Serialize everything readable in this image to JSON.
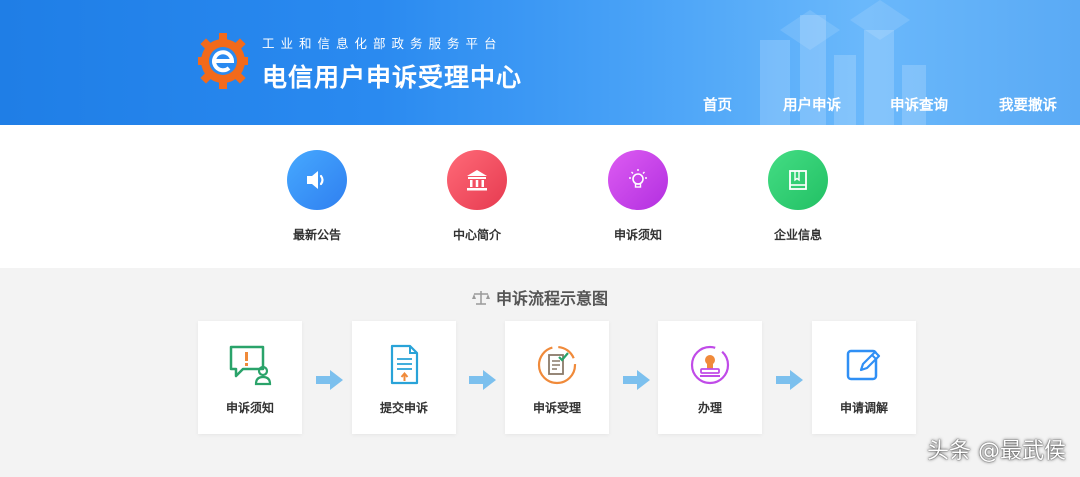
{
  "header": {
    "subtitle": "工业和信息化部政务服务平台",
    "title": "电信用户申诉受理中心",
    "logo_icon": "e-gear-logo-icon",
    "nav": [
      {
        "label": "首页"
      },
      {
        "label": "用户申诉"
      },
      {
        "label": "申诉查询"
      },
      {
        "label": "我要撤诉"
      }
    ]
  },
  "quick_links": [
    {
      "label": "最新公告",
      "icon": "speaker-icon",
      "color": "#2f8ff5"
    },
    {
      "label": "中心简介",
      "icon": "building-icon",
      "color": "#f24d5e"
    },
    {
      "label": "申诉须知",
      "icon": "lightbulb-icon",
      "color": "#c63ee6"
    },
    {
      "label": "企业信息",
      "icon": "book-icon",
      "color": "#2ecc71"
    }
  ],
  "process": {
    "title": "申诉流程示意图",
    "title_icon": "scale-icon",
    "steps": [
      {
        "label": "申诉须知",
        "icon": "notice-chat-icon"
      },
      {
        "label": "提交申诉",
        "icon": "submit-document-icon"
      },
      {
        "label": "申诉受理",
        "icon": "accept-document-icon"
      },
      {
        "label": "办理",
        "icon": "stamp-icon"
      },
      {
        "label": "申请调解",
        "icon": "edit-icon"
      }
    ]
  },
  "watermark": "头条 @最武侯"
}
